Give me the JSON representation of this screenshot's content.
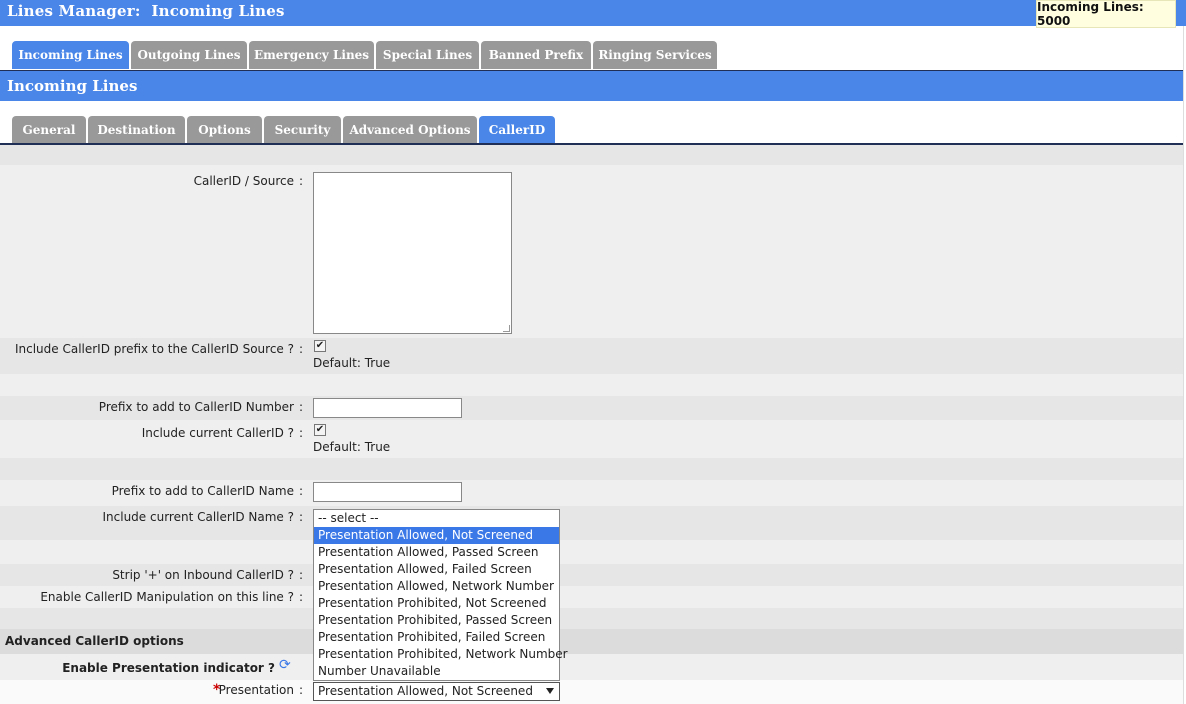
{
  "header": {
    "title": "Lines Manager:  Incoming Lines",
    "badge": "Incoming Lines: 5000"
  },
  "main_tabs": [
    {
      "label": "Incoming Lines",
      "active": true
    },
    {
      "label": "Outgoing Lines",
      "active": false
    },
    {
      "label": "Emergency Lines",
      "active": false
    },
    {
      "label": "Special Lines",
      "active": false
    },
    {
      "label": "Banned Prefix",
      "active": false
    },
    {
      "label": "Ringing Services",
      "active": false
    }
  ],
  "section_title": "Incoming Lines",
  "sub_tabs": [
    {
      "label": "General",
      "active": false
    },
    {
      "label": "Destination",
      "active": false
    },
    {
      "label": "Options",
      "active": false
    },
    {
      "label": "Security",
      "active": false
    },
    {
      "label": "Advanced Options",
      "active": false
    },
    {
      "label": "CallerID",
      "active": true
    }
  ],
  "form": {
    "callerid_source_label": "CallerID / Source",
    "callerid_source_value": "",
    "include_prefix_label": "Include CallerID prefix to the CallerID Source ?",
    "include_prefix_checked": true,
    "include_prefix_default": "Default: True",
    "prefix_number_label": "Prefix to add to CallerID Number",
    "prefix_number_value": "",
    "include_current_label": "Include current CallerID ?",
    "include_current_checked": true,
    "include_current_default": "Default: True",
    "prefix_name_label": "Prefix to add to CallerID Name",
    "prefix_name_value": "",
    "include_name_label": "Include current CallerID Name ?",
    "strip_plus_label": "Strip '+' on Inbound CallerID ?",
    "enable_manip_label": "Enable CallerID Manipulation on this line ?",
    "colon": ":"
  },
  "advanced": {
    "header": "Advanced CallerID options",
    "presentation_indicator_label": "Enable Presentation indicator ?",
    "required_mark": "*",
    "presentation_label": "Presentation",
    "presentation_selected": "Presentation Allowed, Not Screened"
  },
  "dropdown": {
    "options": [
      "-- select --",
      "Presentation Allowed, Not Screened",
      "Presentation Allowed, Passed Screen",
      "Presentation Allowed, Failed Screen",
      "Presentation Allowed, Network Number",
      "Presentation Prohibited, Not Screened",
      "Presentation Prohibited, Passed Screen",
      "Presentation Prohibited, Failed Screen",
      "Presentation Prohibited, Network Number",
      "Number Unavailable"
    ],
    "highlighted_index": 1
  },
  "icons": {
    "checkmark": "✔",
    "refresh": "⟳"
  },
  "colors": {
    "accent": "#4a86e8",
    "tab_inactive": "#999999",
    "required": "#cc0000"
  }
}
